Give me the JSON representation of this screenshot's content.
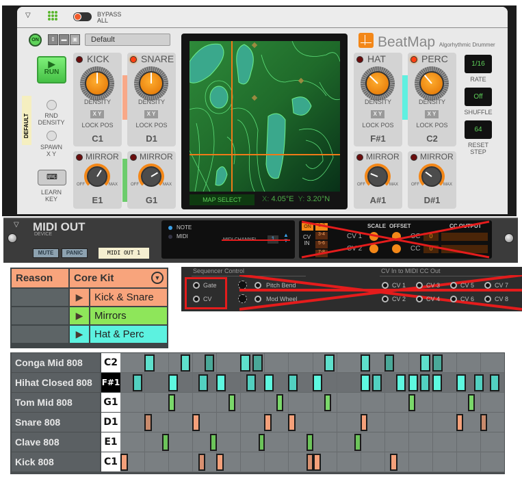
{
  "device": {
    "bypass_label_1": "BYPASS",
    "bypass_label_2": "ALL",
    "on_label": "ON",
    "preset_name": "Default",
    "run_label": "RUN",
    "default_tape": "DEFAULT",
    "rnd_label_1": "RND",
    "rnd_label_2": "DENSITY",
    "spawn_label_1": "SPAWN",
    "spawn_label_2": "X Y",
    "learn_label_1": "LEARN",
    "learn_label_2": "KEY",
    "brand": "BeatMap",
    "brand_sub": "Algorhythmic Drummer",
    "accent": "#f38718",
    "map_select_label": "MAP SELECT",
    "map_x_label": "X:",
    "map_x_value": "4.05°E",
    "map_y_label": "Y:",
    "map_y_value": "3.20°N",
    "rate_value": "1/16",
    "rate_label": "RATE",
    "shuffle_value": "Off",
    "shuffle_label": "SHUFFLE",
    "reset_value": "64",
    "reset_label_1": "RESET",
    "reset_label_2": "STEP",
    "density_label": "DENSITY",
    "xy_label": "X Y",
    "lock_label": "LOCK POS",
    "mirror_label": "MIRROR",
    "off_label": "OFF",
    "max_label": "MAX",
    "channels": [
      {
        "name": "KICK",
        "led_on": false,
        "density": 0.5,
        "note": "C1",
        "mirror": 0.62,
        "mirror_note": "E1"
      },
      {
        "name": "SNARE",
        "led_on": true,
        "density": 0.5,
        "note": "D1",
        "mirror": 0.72,
        "mirror_note": "G1"
      },
      {
        "name": "HAT",
        "led_on": false,
        "density": 0.33,
        "note": "F#1",
        "mirror": 0.25,
        "mirror_note": "A#1"
      },
      {
        "name": "PERC",
        "led_on": true,
        "density": 0.35,
        "note": "C2",
        "mirror": 0.3,
        "mirror_note": "D#1"
      }
    ],
    "pair_colors": [
      "#f8a888",
      "#6ccc6c",
      "#5ff0e0"
    ]
  },
  "midi_out": {
    "title": "MIDI OUT",
    "subtitle": "DEVICE",
    "mute": "MUTE",
    "panic": "PANIC",
    "tape": "MIDI OUT 1",
    "note_label": "NOTE",
    "midi_label": "MIDI",
    "channel_label": "MIDI CHANNEL",
    "channel_value": "1",
    "on_label": "ON",
    "cv_in_1": "CV",
    "cv_in_2": "IN",
    "pairs": [
      "1-2",
      "3-4",
      "5-6",
      "7-8"
    ],
    "scale_label": "SCALE",
    "offset_label": "OFFSET",
    "cc_output_label": "CC OUTPUT",
    "cv1": "CV 1",
    "cv2": "CV 2",
    "cc": "CC",
    "cc_value": "0"
  },
  "kit_table": {
    "header": [
      "Reason",
      "Core Kit"
    ],
    "rows": [
      {
        "label": "Kick & Snare",
        "color": "#f8a47c"
      },
      {
        "label": "Mirrors",
        "color": "#8ee65a"
      },
      {
        "label": "Hat & Perc",
        "color": "#5cf2e0"
      }
    ]
  },
  "sequencer": {
    "title": "Sequencer Control",
    "gate": "Gate",
    "cv": "CV",
    "pitch_bend": "Pitch Bend",
    "mod_wheel": "Mod Wheel",
    "cc_title": "CV In to MIDI CC Out",
    "cv_jacks": [
      "CV 1",
      "CV 3",
      "CV 5",
      "CV 7",
      "CV 2",
      "CV 4",
      "CV 6",
      "CV 8"
    ]
  },
  "piano_roll": {
    "steps": 16,
    "rows": [
      {
        "name": "Conga Mid 808",
        "key": "C2",
        "color": "#5ee0cc",
        "dim": "#4aa898",
        "w": 0.42,
        "notes": [
          [
            1,
            1
          ],
          [
            2.5,
            1
          ],
          [
            3.5,
            0
          ],
          [
            5,
            1
          ],
          [
            5.5,
            0
          ],
          [
            8.5,
            1
          ],
          [
            10,
            1
          ],
          [
            11,
            0
          ],
          [
            12.5,
            1
          ],
          [
            13,
            0
          ]
        ]
      },
      {
        "name": "Hihat Closed 808",
        "key": "F#1",
        "color": "#5ef8e0",
        "dim": "#52d0c0",
        "w": 0.4,
        "notes": [
          [
            0.5,
            0
          ],
          [
            2,
            1
          ],
          [
            3.25,
            0
          ],
          [
            4,
            1
          ],
          [
            5.25,
            0
          ],
          [
            6,
            1
          ],
          [
            7,
            0
          ],
          [
            8,
            1
          ],
          [
            10,
            1
          ],
          [
            10.5,
            0
          ],
          [
            11.5,
            1
          ],
          [
            12,
            1
          ],
          [
            12.5,
            0
          ],
          [
            13,
            1
          ],
          [
            14,
            1
          ],
          [
            14.75,
            0
          ],
          [
            15.4,
            0
          ]
        ]
      },
      {
        "name": "Tom Mid 808",
        "key": "G1",
        "color": "#7ad86a",
        "dim": "#7ad86a",
        "w": 0.28,
        "notes": [
          [
            2,
            1
          ],
          [
            4.5,
            1
          ],
          [
            6.5,
            1
          ],
          [
            8.5,
            1
          ],
          [
            12,
            1
          ],
          [
            14.5,
            1
          ]
        ]
      },
      {
        "name": "Snare 808",
        "key": "D1",
        "color": "#f4a07a",
        "dim": "#c88a6c",
        "w": 0.3,
        "notes": [
          [
            1,
            0
          ],
          [
            3,
            1
          ],
          [
            6,
            1
          ],
          [
            7,
            1
          ],
          [
            10,
            1
          ],
          [
            14,
            1
          ],
          [
            15,
            0
          ]
        ]
      },
      {
        "name": "Clave 808",
        "key": "E1",
        "color": "#6cc45a",
        "dim": "#6cc45a",
        "w": 0.28,
        "notes": [
          [
            1.75,
            1
          ],
          [
            3.75,
            1
          ],
          [
            5.75,
            1
          ],
          [
            7.75,
            1
          ],
          [
            9.75,
            1
          ]
        ]
      },
      {
        "name": "Kick 808",
        "key": "C1",
        "color": "#f4a07a",
        "dim": "#d89070",
        "w": 0.3,
        "notes": [
          [
            0,
            1
          ],
          [
            3.25,
            0
          ],
          [
            4,
            1
          ],
          [
            7.75,
            0
          ],
          [
            8.05,
            1
          ],
          [
            11.25,
            1
          ]
        ]
      }
    ]
  }
}
